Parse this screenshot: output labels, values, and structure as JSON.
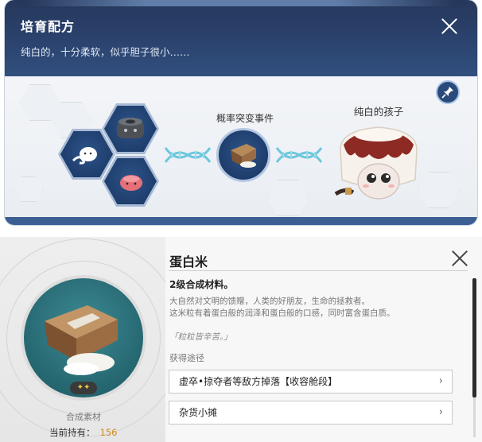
{
  "recipe_panel": {
    "title": "培育配方",
    "description": "纯白的，十分柔软，似乎胆子很小……",
    "event_label": "概率突变事件",
    "result_label": "纯白的孩子",
    "header_color": "#2c4470",
    "ingredients": [
      {
        "icon": "gray-creature-icon"
      },
      {
        "icon": "white-creature-icon"
      },
      {
        "icon": "pink-creature-icon"
      }
    ],
    "event_icon": "protein-rice-bag-icon",
    "result_icon": "white-cake-creature-icon"
  },
  "item_panel": {
    "name": "蛋白米",
    "subtitle": "2级合成材料。",
    "description_lines": [
      "大自然对文明的馈赠，人类的好朋友，生命的拯救者。",
      "这米粒有着蛋白般的润泽和蛋白般的口感，同时富含蛋白质。"
    ],
    "quote": "「粒粒皆辛苦。」",
    "acquisition_label": "获得途径",
    "sources": [
      {
        "label": "虚卒•掠夺者等敌方掉落【收容舱段】"
      },
      {
        "label": "杂货小摊"
      }
    ],
    "stars": "✦✦",
    "type_label": "合成素材",
    "owned_label": "当前持有：",
    "owned_count": "156",
    "accent_color": "#d48a1c"
  }
}
